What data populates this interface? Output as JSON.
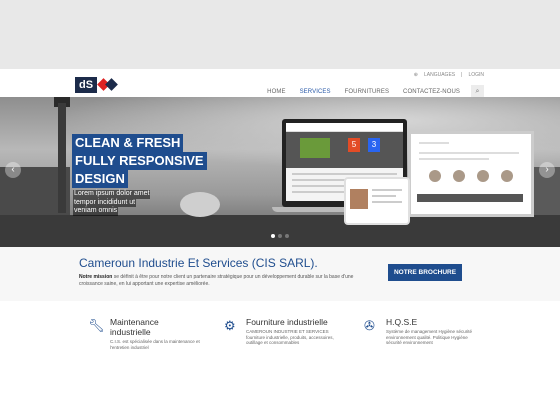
{
  "header": {
    "logo_text": "dS",
    "utility": {
      "languages": "LANGUAGES",
      "login": "LOGIN"
    },
    "nav": [
      {
        "label": "HOME"
      },
      {
        "label": "SERVICES"
      },
      {
        "label": "FOURNITURES"
      },
      {
        "label": "CONTACTEZ-NOUS"
      }
    ]
  },
  "hero": {
    "captions": [
      "CLEAN & FRESH",
      "FULLY RESPONSIVE",
      "DESIGN"
    ],
    "lorem": [
      "Lorem ipsum dolor amet",
      "tempor incididunt ut",
      "veniam omnis"
    ],
    "html5": "5",
    "css3": "3"
  },
  "intro": {
    "title": "Cameroun Industrie Et Services (CIS SARL).",
    "text_bold": "Notre mission",
    "text": " se définit à être pour notre client un partenaire stratégique pour un développement durable sur la base d'une croissance saine, en lui apportant une expertise améliorée.",
    "button": "NOTRE BROCHURE"
  },
  "features": [
    {
      "title": "Maintenance industrielle",
      "text": "C.I.S. est spécialisée dans la maintenance et l'entretien industriel",
      "icon": "wrench-icon"
    },
    {
      "title": "Fourniture industrielle",
      "text": "CAMEROUN INDUSTRIE ET SERVICES fourniture industrielle, produits, accessoires, outillage et consommables",
      "icon": "gears-icon"
    },
    {
      "title": "H.Q.S.E",
      "text": "Système de management Hygiène sécurité environnement qualité. Politique Hygiène sécurité environnement",
      "icon": "wrench-alt-icon"
    }
  ],
  "colors": {
    "brand": "#1f4d8e",
    "accent_red": "#dd2222"
  }
}
